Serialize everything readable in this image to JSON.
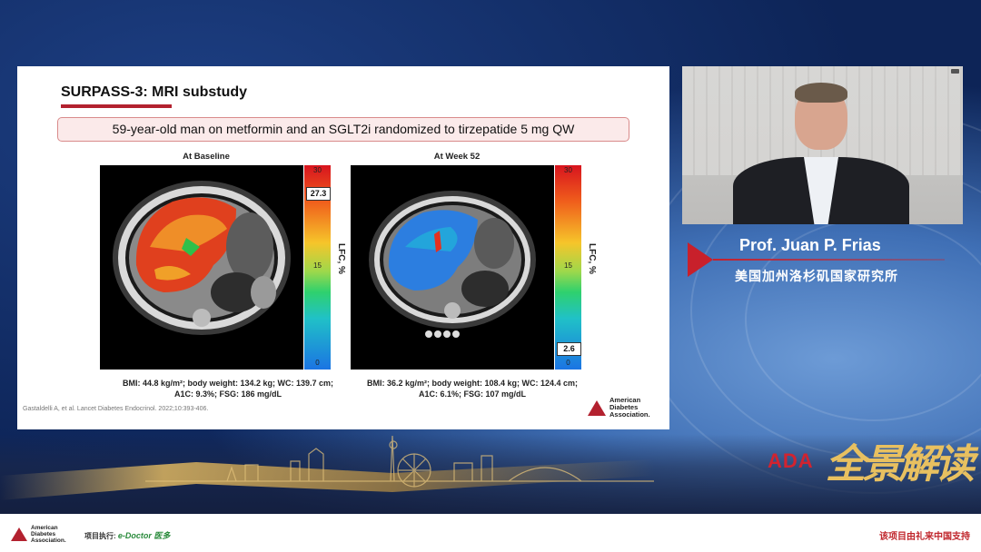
{
  "slide": {
    "title": "SURPASS-3: MRI substudy",
    "subtitle": "59-year-old man on metformin and an SGLT2i randomized to tirzepatide 5 mg QW",
    "panels": [
      {
        "label": "At Baseline",
        "scale_top": "30",
        "scale_mid": "15",
        "scale_bottom": "0",
        "value": "27.3",
        "lfc_label": "LFC, %",
        "caption_line1": "BMI: 44.8 kg/m²; body weight: 134.2 kg; WC: 139.7 cm;",
        "caption_line2": "A1C: 9.3%; FSG: 186 mg/dL"
      },
      {
        "label": "At Week 52",
        "scale_top": "30",
        "scale_mid": "15",
        "scale_bottom": "0",
        "value": "2.6",
        "lfc_label": "LFC, %",
        "caption_line1": "BMI: 36.2 kg/m²; body weight: 108.4 kg; WC: 124.4 cm;",
        "caption_line2": "A1C: 6.1%; FSG: 107 mg/dL"
      }
    ],
    "reference": "Gastaldelli A, et al. Lancet Diabetes Endocrinol. 2022;10:393-406.",
    "logo_text": [
      "American",
      "Diabetes",
      "Association."
    ]
  },
  "speaker": {
    "name": "Prof. Juan P. Frias",
    "affiliation": "美国加州洛杉矶国家研究所"
  },
  "brand": {
    "ada": "ADA",
    "cn": "全景解读"
  },
  "footer": {
    "logo_text": [
      "American",
      "Diabetes",
      "Association."
    ],
    "exec_label": "项目执行:",
    "exec_logo": "e-Doctor 医多",
    "support": "该项目由礼来中国支持"
  },
  "colors": {
    "accent_red": "#b3212f",
    "gold": "#e8c060"
  }
}
